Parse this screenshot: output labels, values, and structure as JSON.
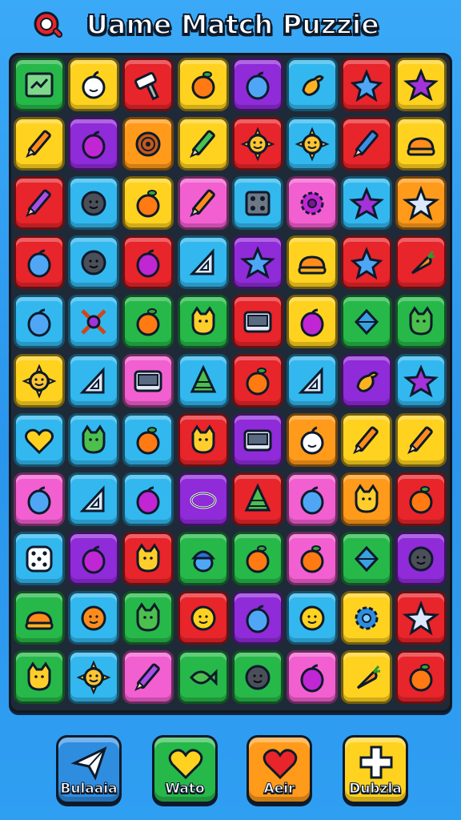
{
  "header": {
    "title": "Uame Match Puzzie",
    "logo_icon": "magnifier-badge-icon"
  },
  "colors": {
    "green": "#27b84a",
    "yellow": "#ffd21f",
    "red": "#e7252b",
    "orange": "#ff9a1a",
    "purple": "#8f2bd8",
    "cyan": "#32b8ef",
    "pink": "#f25fd0",
    "blue": "#2f8de0"
  },
  "board": {
    "rows": 11,
    "cols": 8,
    "tiles": [
      [
        [
          "green",
          "map"
        ],
        [
          "yellow",
          "apple-white"
        ],
        [
          "red",
          "hammer"
        ],
        [
          "yellow",
          "orange"
        ],
        [
          "purple",
          "plum-blue"
        ],
        [
          "cyan",
          "duck"
        ],
        [
          "red",
          "starfish"
        ],
        [
          "yellow",
          "star-purple"
        ]
      ],
      [
        [
          "yellow",
          "pencil"
        ],
        [
          "purple",
          "plum"
        ],
        [
          "orange",
          "spiral"
        ],
        [
          "yellow",
          "pencil-green"
        ],
        [
          "red",
          "sun"
        ],
        [
          "cyan",
          "sun"
        ],
        [
          "red",
          "pencil-blue"
        ],
        [
          "yellow",
          "bread"
        ]
      ],
      [
        [
          "red",
          "pencil-purple"
        ],
        [
          "cyan",
          "ball-dark"
        ],
        [
          "yellow",
          "orange"
        ],
        [
          "pink",
          "pencil"
        ],
        [
          "cyan",
          "chip"
        ],
        [
          "pink",
          "gear"
        ],
        [
          "cyan",
          "star-purple"
        ],
        [
          "orange",
          "star-white"
        ]
      ],
      [
        [
          "red",
          "plum-blue"
        ],
        [
          "cyan",
          "ball-dark"
        ],
        [
          "red",
          "plum"
        ],
        [
          "cyan",
          "triangle-ruler"
        ],
        [
          "purple",
          "star-blue"
        ],
        [
          "yellow",
          "bread"
        ],
        [
          "red",
          "starfish"
        ],
        [
          "red",
          "carrot"
        ]
      ],
      [
        [
          "cyan",
          "plum-blue"
        ],
        [
          "cyan",
          "target-x"
        ],
        [
          "green",
          "orange"
        ],
        [
          "green",
          "cat"
        ],
        [
          "red",
          "console"
        ],
        [
          "yellow",
          "plum"
        ],
        [
          "green",
          "gem"
        ],
        [
          "green",
          "cat-green"
        ]
      ],
      [
        [
          "yellow",
          "sun"
        ],
        [
          "cyan",
          "triangle-ruler"
        ],
        [
          "pink",
          "console"
        ],
        [
          "cyan",
          "cone-green"
        ],
        [
          "red",
          "orange"
        ],
        [
          "cyan",
          "triangle-ruler"
        ],
        [
          "purple",
          "duck"
        ],
        [
          "cyan",
          "star-purple"
        ]
      ],
      [
        [
          "cyan",
          "heart-yellow"
        ],
        [
          "cyan",
          "cat-green"
        ],
        [
          "cyan",
          "orange"
        ],
        [
          "red",
          "cat"
        ],
        [
          "purple",
          "console"
        ],
        [
          "orange",
          "apple-white"
        ],
        [
          "yellow",
          "pencil"
        ],
        [
          "yellow",
          "pencil"
        ]
      ],
      [
        [
          "pink",
          "plum-blue"
        ],
        [
          "cyan",
          "triangle-ruler"
        ],
        [
          "cyan",
          "plum"
        ],
        [
          "purple",
          "ring"
        ],
        [
          "red",
          "cone-green"
        ],
        [
          "pink",
          "plum-blue"
        ],
        [
          "orange",
          "cat"
        ],
        [
          "red",
          "orange"
        ]
      ],
      [
        [
          "cyan",
          "dice"
        ],
        [
          "purple",
          "plum"
        ],
        [
          "red",
          "cat"
        ],
        [
          "green",
          "acorn"
        ],
        [
          "green",
          "orange"
        ],
        [
          "pink",
          "orange"
        ],
        [
          "green",
          "gem"
        ],
        [
          "purple",
          "ball-dark"
        ]
      ],
      [
        [
          "green",
          "bread"
        ],
        [
          "cyan",
          "smile-orange"
        ],
        [
          "green",
          "cat-green"
        ],
        [
          "red",
          "smile-yellow"
        ],
        [
          "purple",
          "plum-blue"
        ],
        [
          "cyan",
          "smile-yellow"
        ],
        [
          "yellow",
          "gear-blue"
        ],
        [
          "red",
          "star-white"
        ]
      ],
      [
        [
          "green",
          "cat"
        ],
        [
          "cyan",
          "sun"
        ],
        [
          "pink",
          "pencil-purple"
        ],
        [
          "green",
          "fish-green"
        ],
        [
          "green",
          "ball-dark"
        ],
        [
          "pink",
          "plum"
        ],
        [
          "yellow",
          "carrot"
        ],
        [
          "red",
          "orange"
        ]
      ]
    ]
  },
  "actions": [
    {
      "label": "Bulaaia",
      "icon": "paper-plane-icon",
      "color": "#2f8de0"
    },
    {
      "label": "Wato",
      "icon": "heart-yellow-icon",
      "color": "#27b84a"
    },
    {
      "label": "Aeir",
      "icon": "heart-red-icon",
      "color": "#ff9a1a"
    },
    {
      "label": "Dubzla",
      "icon": "plus-icon",
      "color": "#ffd21f"
    }
  ]
}
